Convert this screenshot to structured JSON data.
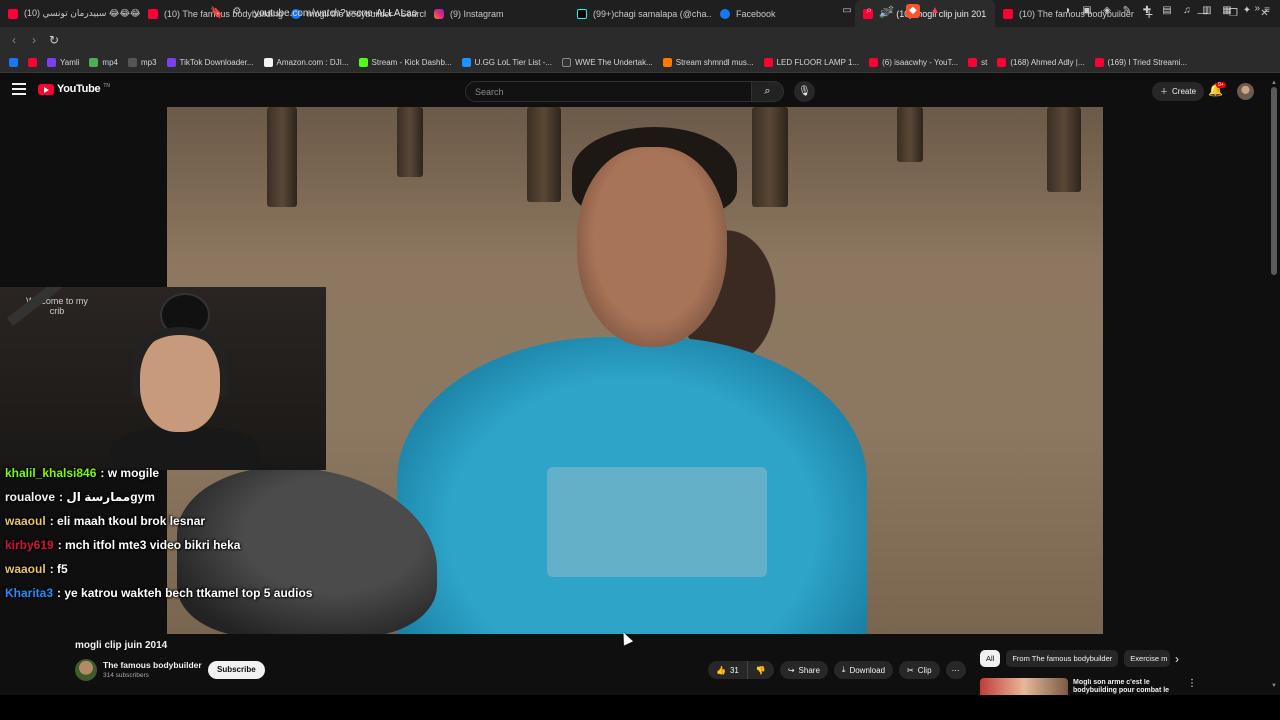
{
  "browser": {
    "tabs": [
      {
        "title": "(10) سبيدرمان تونسي 😂😂😂",
        "favicon": "youtube-icon",
        "active": false
      },
      {
        "title": "(10) The famous bodybuilding",
        "favicon": "youtube-icon",
        "active": false
      },
      {
        "title": "mogli the bodybuilder - Search",
        "favicon": "facebook-icon",
        "active": false
      },
      {
        "title": "(9) Instagram",
        "favicon": "instagram-icon",
        "active": false
      },
      {
        "title": "(99+)chagi samalapa (@cha...",
        "favicon": "tiktok-icon",
        "active": false
      },
      {
        "title": "Facebook",
        "favicon": "facebook-icon",
        "active": false
      },
      {
        "title": "(10) mogli clip juin 201",
        "favicon": "youtube-icon",
        "active": true
      },
      {
        "title": "(10) The famous bodybuilder",
        "favicon": "youtube-icon",
        "active": false
      }
    ],
    "new_tab": "+",
    "url": "youtube.com/watch?v=cne-ALLALao",
    "bookmarks": [
      {
        "label": "",
        "color": "#1877f2"
      },
      {
        "label": "",
        "color": "#ff0033"
      },
      {
        "label": "Yamli",
        "color": "#7b3ff2"
      },
      {
        "label": "mp4",
        "color": "#4caf50"
      },
      {
        "label": "mp3",
        "color": "#555555"
      },
      {
        "label": "TikTok Downloader...",
        "color": "#7b3ff2"
      },
      {
        "label": "Amazon.com : DJI...",
        "color": "#f3f3f3"
      },
      {
        "label": "Stream - Kick Dashb...",
        "color": "#53fc18"
      },
      {
        "label": "U.GG LoL Tier List -...",
        "color": "#1e90ff"
      },
      {
        "label": "WWE The Undertak...",
        "color": "#333333"
      },
      {
        "label": "Stream shmndl mus...",
        "color": "#ff7a00"
      },
      {
        "label": "LED FLOOR LAMP 1...",
        "color": "#ff0033"
      },
      {
        "label": "(6) isaacwhy - YouT...",
        "color": "#ff0033"
      },
      {
        "label": "st",
        "color": "#ff0033"
      },
      {
        "label": "(168) Ahmed Adly |...",
        "color": "#ff0033"
      },
      {
        "label": "(169) I Tried Streami...",
        "color": "#ff0033"
      }
    ]
  },
  "youtube": {
    "logo_text": "YouTube",
    "logo_tm": "TN",
    "search_placeholder": "Search",
    "create_label": "Create",
    "notification_badge": "9+"
  },
  "overlay": {
    "webcam_wall_text": "Welcome to my crib",
    "chat": [
      {
        "user": "khalil_khalsi846",
        "user_color": "#7CFC00",
        "message": "w mogile"
      },
      {
        "user": "roualove",
        "user_color": "#f1f1f1",
        "message": "ممارسة الgym"
      },
      {
        "user": "waaoul",
        "user_color": "#e8c16d",
        "message": "eli maah tkoul brok lesnar"
      },
      {
        "user": "kirby619",
        "user_color": "#d2143a",
        "message": "mch itfol mte3 video bikri heka"
      },
      {
        "user": "waaoul",
        "user_color": "#e8c16d",
        "message": "f5"
      },
      {
        "user": "Kharita3",
        "user_color": "#1e90ff",
        "message": "ye katrou wakteh bech ttkamel top 5 audios"
      }
    ]
  },
  "video": {
    "title": "mogli clip juin 2014",
    "channel_name": "The famous bodybuilder",
    "subscribers": "314 subscribers",
    "subscribe_label": "Subscribe",
    "likes": "31",
    "share_label": "Share",
    "download_label": "Download",
    "clip_label": "Clip"
  },
  "sidebar": {
    "chips": [
      "All",
      "From The famous bodybuilder",
      "Exercise m"
    ],
    "recommendation_title": "Mogli son arme c'est le bodybuilding pour combat le"
  }
}
